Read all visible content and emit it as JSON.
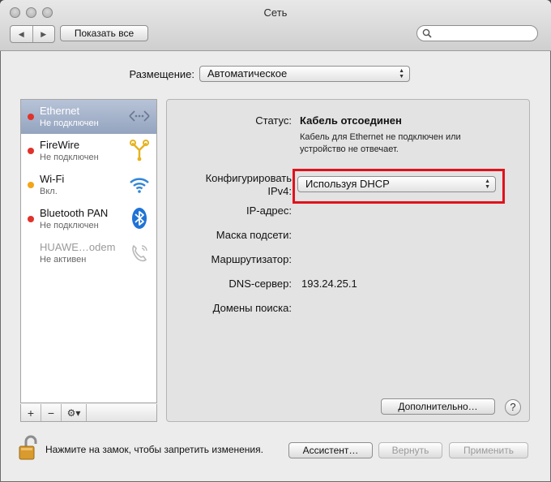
{
  "window": {
    "title": "Сеть"
  },
  "toolbar": {
    "show_all_label": "Показать все",
    "back_glyph": "◀",
    "forward_glyph": "▶",
    "search_placeholder": ""
  },
  "location": {
    "label": "Размещение:",
    "value": "Автоматическое"
  },
  "sidebar": {
    "items": [
      {
        "name": "Ethernet",
        "status": "Не подключен",
        "dot_color": "#e0322b",
        "icon": "ethernet-icon",
        "selected": true
      },
      {
        "name": "FireWire",
        "status": "Не подключен",
        "dot_color": "#e0322b",
        "icon": "firewire-icon"
      },
      {
        "name": "Wi-Fi",
        "status": "Вкл.",
        "dot_color": "#f2a51a",
        "icon": "wifi-icon"
      },
      {
        "name": "Bluetooth PAN",
        "status": "Не подключен",
        "dot_color": "#e0322b",
        "icon": "bluetooth-icon"
      },
      {
        "name": "HUAWE…odem",
        "status": "Не активен",
        "dot_color": "",
        "icon": "phone-modem-icon",
        "inactive": true
      }
    ],
    "add_glyph": "+",
    "remove_glyph": "−",
    "gear_glyph": "⚙▾"
  },
  "detail": {
    "status_label": "Статус:",
    "status_value": "Кабель отсоединен",
    "status_note_line1": "Кабель для Ethernet не подключен или",
    "status_note_line2": "устройство не отвечает.",
    "configure_label_line1": "Конфигурировать",
    "configure_label_line2": "IPv4:",
    "configure_value": "Используя DHCP",
    "ip_label": "IP-адрес:",
    "mask_label": "Маска подсети:",
    "router_label": "Маршрутизатор:",
    "dns_label": "DNS-сервер:",
    "dns_value": "193.24.25.1",
    "domains_label": "Домены поиска:",
    "advanced_label": "Дополнительно…",
    "help_glyph": "?"
  },
  "footer": {
    "lock_text": "Нажмите на замок, чтобы запретить изменения.",
    "assistant_label": "Ассистент…",
    "revert_label": "Вернуть",
    "apply_label": "Применить"
  },
  "colors": {
    "highlight": "#e0121b",
    "selected_row": "#a3b1c9"
  }
}
